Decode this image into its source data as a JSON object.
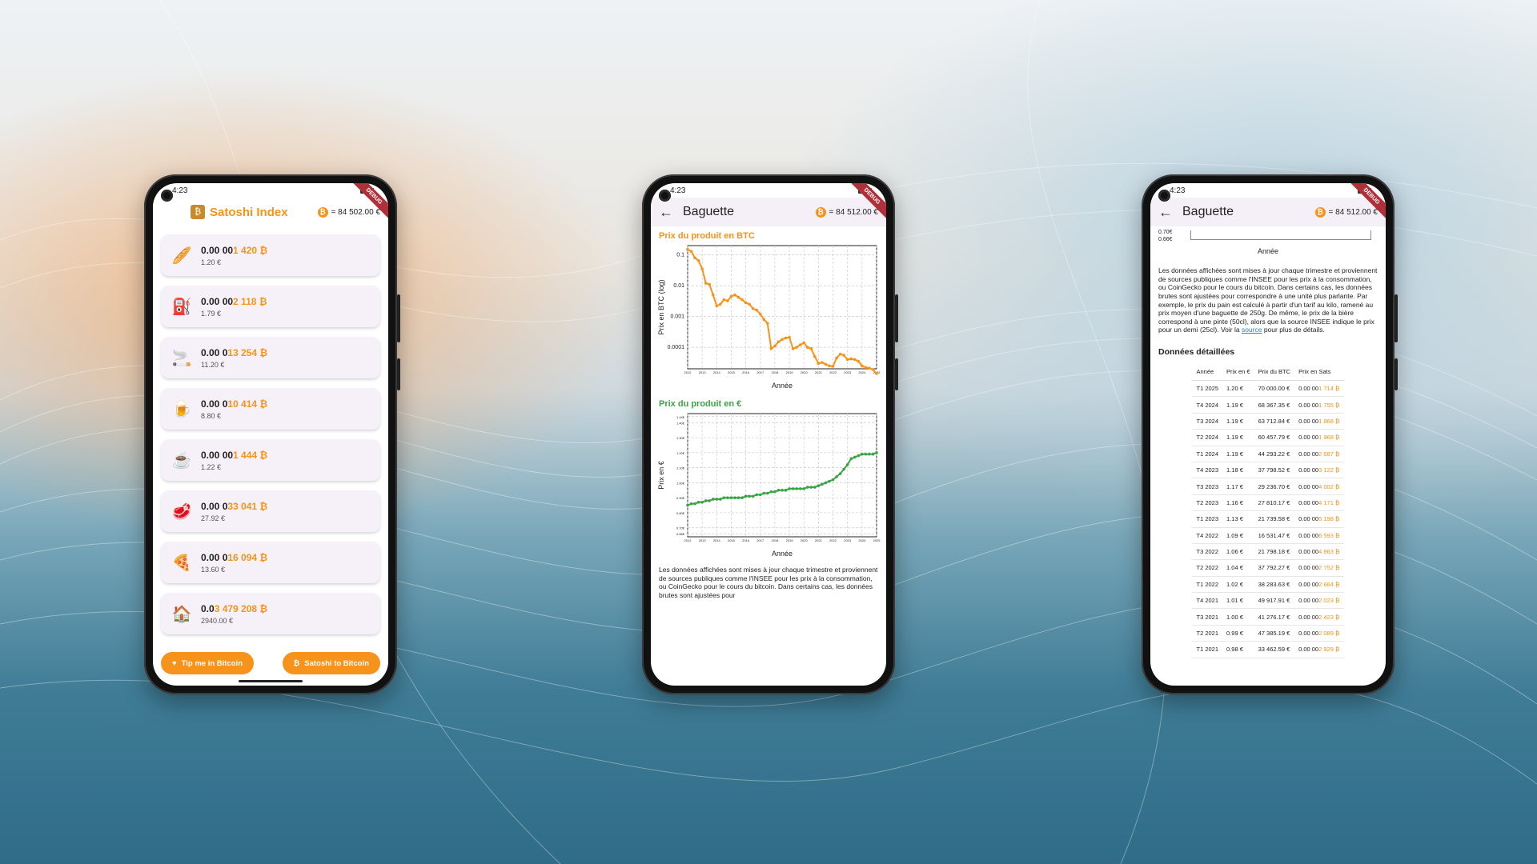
{
  "colors": {
    "accent": "#f7931a",
    "green": "#3aa545",
    "link": "#2a7fd4"
  },
  "status_time": "4:23",
  "phone1": {
    "app_title": "Satoshi Index",
    "btc_rate": "= 84 502.00 €",
    "ribbon": "DEBUG",
    "items": [
      {
        "icon": "baguette-icon",
        "glyph": "🥖",
        "prefix": "0.00 00",
        "value": "1 420 ₿",
        "eur": "1.20 €"
      },
      {
        "icon": "fuel-pump-icon",
        "glyph": "⛽",
        "prefix": "0.00 00",
        "value": "2 118 ₿",
        "eur": "1.79 €"
      },
      {
        "icon": "cigarette-icon",
        "glyph": "🚬",
        "prefix": "0.00 0",
        "value": "13 254 ₿",
        "eur": "11.20 €"
      },
      {
        "icon": "beer-icon",
        "glyph": "🍺",
        "prefix": "0.00 0",
        "value": "10 414 ₿",
        "eur": "8.80 €"
      },
      {
        "icon": "coffee-icon",
        "glyph": "☕",
        "prefix": "0.00 00",
        "value": "1 444 ₿",
        "eur": "1.22 €"
      },
      {
        "icon": "meat-icon",
        "glyph": "🥩",
        "prefix": "0.00 0",
        "value": "33 041 ₿",
        "eur": "27.92 €"
      },
      {
        "icon": "pizza-icon",
        "glyph": "🍕",
        "prefix": "0.00 0",
        "value": "16 094 ₿",
        "eur": "13.60 €"
      },
      {
        "icon": "house-icon",
        "glyph": "🏠",
        "prefix": "0.0",
        "value": "3 479 208 ₿",
        "eur": "2940.00 €"
      }
    ],
    "tip_label": "Tip me in Bitcoin",
    "convert_label": "Satoshi to Bitcoin"
  },
  "phone2": {
    "title": "Baguette",
    "btc_rate": "= 84 512.00 €",
    "chart_btc_title": "Prix du produit en BTC",
    "chart_eur_title": "Prix du produit en €",
    "xlabel": "Année",
    "description": "Les données affichées sont mises à jour chaque trimestre et proviennent de sources publiques comme l'INSEE pour les prix à la consommation, ou CoinGecko pour le cours du bitcoin. Dans certains cas, les données brutes sont ajustées pour"
  },
  "chart_data": [
    {
      "type": "line",
      "title": "Prix du produit en BTC",
      "xlabel": "Année",
      "ylabel": "Prix en BTC (log)",
      "yscale": "log",
      "ylim": [
        2e-05,
        0.2
      ],
      "yticks": [
        "0.1",
        "0.01",
        "0.001",
        "0.0001"
      ],
      "xticks": [
        "2012",
        "2013",
        "2014",
        "2015",
        "2016",
        "2017",
        "2018",
        "2019",
        "2020",
        "2021",
        "2022",
        "2023",
        "2024",
        "2025"
      ],
      "grid": true,
      "series": [
        {
          "x": [
            2012.0,
            2012.25,
            2012.5,
            2012.75,
            2013.0,
            2013.25,
            2013.5,
            2013.75,
            2014.0,
            2014.25,
            2014.5,
            2014.75,
            2015.0,
            2015.25,
            2015.5,
            2015.75,
            2016.0,
            2016.25,
            2016.5,
            2016.75,
            2017.0,
            2017.25,
            2017.5,
            2017.75,
            2018.0,
            2018.25,
            2018.5,
            2018.75,
            2019.0,
            2019.25,
            2019.5,
            2019.75,
            2020.0,
            2020.25,
            2020.5,
            2020.75,
            2021.0,
            2021.25,
            2021.5,
            2021.75,
            2022.0,
            2022.25,
            2022.5,
            2022.75,
            2023.0,
            2023.25,
            2023.5,
            2023.75,
            2024.0,
            2024.25,
            2024.5,
            2024.75,
            2025.0
          ],
          "y": [
            0.15,
            0.13,
            0.08,
            0.065,
            0.035,
            0.012,
            0.011,
            0.005,
            0.0022,
            0.0025,
            0.0035,
            0.0032,
            0.0045,
            0.005,
            0.0042,
            0.0035,
            0.0028,
            0.0025,
            0.0018,
            0.0016,
            0.0012,
            0.0008,
            0.0006,
            9e-05,
            0.00011,
            0.00015,
            0.00018,
            0.0002,
            0.00021,
            9e-05,
            0.0001,
            0.00012,
            0.00014,
            0.0001,
            9e-05,
            5e-05,
            3e-05,
            3.2e-05,
            2.8e-05,
            2.5e-05,
            2.4e-05,
            4.5e-05,
            6e-05,
            5.5e-05,
            4e-05,
            4.2e-05,
            4e-05,
            3.5e-05,
            2.5e-05,
            2.2e-05,
            2.1e-05,
            1.9e-05,
            1.4e-05
          ]
        }
      ]
    },
    {
      "type": "line",
      "title": "Prix du produit en €",
      "xlabel": "Année",
      "ylabel": "Prix en €",
      "ylim": [
        0.64,
        1.46
      ],
      "yticks": [
        "1.44€",
        "1.40€",
        "1.30€",
        "1.20€",
        "1.10€",
        "1.00€",
        "0.90€",
        "0.80€",
        "0.70€",
        "0.66€"
      ],
      "xticks": [
        "2012",
        "2013",
        "2014",
        "2015",
        "2016",
        "2017",
        "2018",
        "2019",
        "2020",
        "2021",
        "2022",
        "2023",
        "2024",
        "2025"
      ],
      "grid": true,
      "series": [
        {
          "x": [
            2012.0,
            2012.25,
            2012.5,
            2012.75,
            2013.0,
            2013.25,
            2013.5,
            2013.75,
            2014.0,
            2014.25,
            2014.5,
            2014.75,
            2015.0,
            2015.25,
            2015.5,
            2015.75,
            2016.0,
            2016.25,
            2016.5,
            2016.75,
            2017.0,
            2017.25,
            2017.5,
            2017.75,
            2018.0,
            2018.25,
            2018.5,
            2018.75,
            2019.0,
            2019.25,
            2019.5,
            2019.75,
            2020.0,
            2020.25,
            2020.5,
            2020.75,
            2021.0,
            2021.25,
            2021.5,
            2021.75,
            2022.0,
            2022.25,
            2022.5,
            2022.75,
            2023.0,
            2023.25,
            2023.5,
            2023.75,
            2024.0,
            2024.25,
            2024.5,
            2024.75,
            2025.0
          ],
          "y": [
            0.85,
            0.86,
            0.86,
            0.87,
            0.87,
            0.88,
            0.88,
            0.89,
            0.89,
            0.89,
            0.9,
            0.9,
            0.9,
            0.9,
            0.9,
            0.9,
            0.91,
            0.91,
            0.91,
            0.92,
            0.92,
            0.93,
            0.93,
            0.94,
            0.94,
            0.95,
            0.95,
            0.95,
            0.96,
            0.96,
            0.96,
            0.96,
            0.96,
            0.97,
            0.97,
            0.97,
            0.98,
            0.99,
            1.0,
            1.01,
            1.02,
            1.04,
            1.06,
            1.09,
            1.12,
            1.16,
            1.17,
            1.18,
            1.19,
            1.19,
            1.19,
            1.19,
            1.2
          ]
        }
      ]
    }
  ],
  "phone3": {
    "title": "Baguette",
    "btc_rate": "= 84 512.00 €",
    "mini_ylabels": [
      "0.70€",
      "0.66€"
    ],
    "xlabel": "Année",
    "description_pre": "Les données affichées sont mises à jour chaque trimestre et proviennent de sources publiques comme l'INSEE pour les prix à la consommation, ou CoinGecko pour le cours du bitcoin. Dans certains cas, les données brutes sont ajustées pour correspondre à une unité plus parlante. Par exemple, le prix du pain est calculé à partir d'un tarif au kilo, ramené au prix moyen d'une baguette de 250g. De même, le prix de la bière correspond à une pinte (50cl), alors que la source INSEE indique le prix pour un demi (25cl). Voir la ",
    "source_link": "source",
    "description_post": " pour plus de détails.",
    "section_title": "Données détaillées",
    "columns": [
      "Année",
      "Prix en €",
      "Prix du BTC",
      "Prix en Sats"
    ],
    "rows": [
      [
        "T1 2025",
        "1.20 €",
        "70 000.00 €",
        "0.00 00",
        "1 714 ₿"
      ],
      [
        "T4 2024",
        "1.19 €",
        "68 367.35 €",
        "0.00 00",
        "1 755 ₿"
      ],
      [
        "T3 2024",
        "1.19 €",
        "63 712.84 €",
        "0.00 00",
        "1 868 ₿"
      ],
      [
        "T2 2024",
        "1.19 €",
        "60 457.79 €",
        "0.00 00",
        "1 968 ₿"
      ],
      [
        "T1 2024",
        "1.19 €",
        "44 293.22 €",
        "0.00 00",
        "2 687 ₿"
      ],
      [
        "T4 2023",
        "1.18 €",
        "37 798.52 €",
        "0.00 00",
        "3 122 ₿"
      ],
      [
        "T3 2023",
        "1.17 €",
        "29 236.70 €",
        "0.00 00",
        "4 002 ₿"
      ],
      [
        "T2 2023",
        "1.16 €",
        "27 810.17 €",
        "0.00 00",
        "4 171 ₿"
      ],
      [
        "T1 2023",
        "1.13 €",
        "21 739.58 €",
        "0.00 00",
        "5 198 ₿"
      ],
      [
        "T4 2022",
        "1.09 €",
        "16 531.47 €",
        "0.00 00",
        "6 593 ₿"
      ],
      [
        "T3 2022",
        "1.06 €",
        "21 798.18 €",
        "0.00 00",
        "4 863 ₿"
      ],
      [
        "T2 2022",
        "1.04 €",
        "37 792.27 €",
        "0.00 00",
        "2 752 ₿"
      ],
      [
        "T1 2022",
        "1.02 €",
        "38 283.63 €",
        "0.00 00",
        "2 664 ₿"
      ],
      [
        "T4 2021",
        "1.01 €",
        "49 917.91 €",
        "0.00 00",
        "2 023 ₿"
      ],
      [
        "T3 2021",
        "1.00 €",
        "41 276.17 €",
        "0.00 00",
        "2 423 ₿"
      ],
      [
        "T2 2021",
        "0.99 €",
        "47 385.19 €",
        "0.00 00",
        "2 089 ₿"
      ],
      [
        "T1 2021",
        "0.98 €",
        "33 462.59 €",
        "0.00 00",
        "2 929 ₿"
      ]
    ]
  }
}
